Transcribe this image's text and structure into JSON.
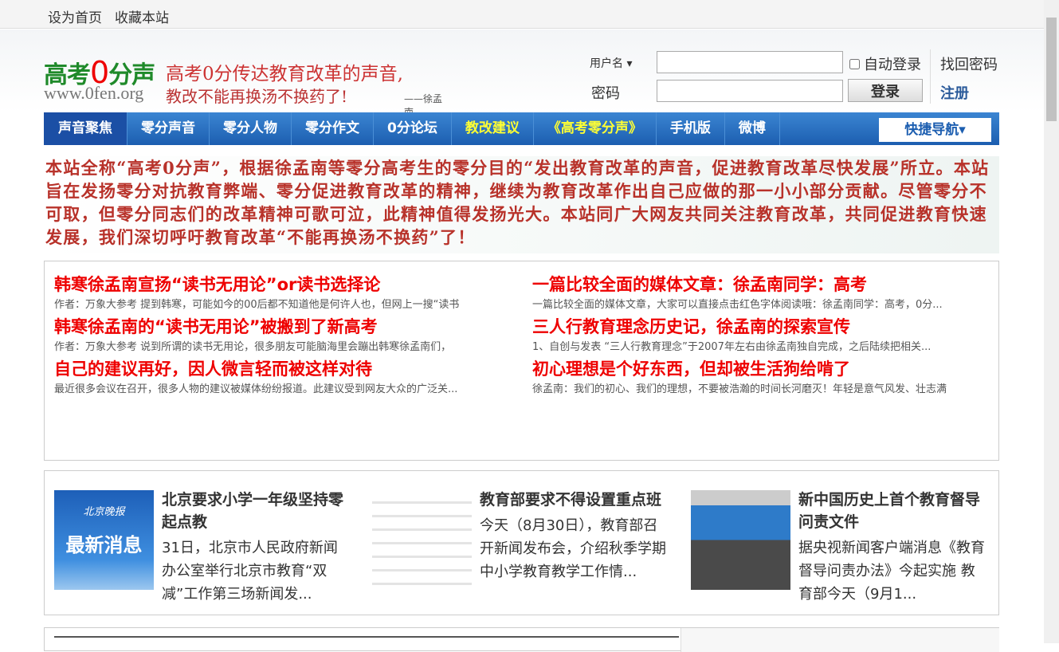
{
  "topbar": {
    "set_home": "设为首页",
    "bookmark": "收藏本站"
  },
  "logo": {
    "name_a": "高考",
    "name_zero": "0",
    "name_b": "分声",
    "slogan1": "高考0分传达教育改革的声音,",
    "url": "www.0fen.org",
    "slogan2": "教改不能再换汤不换药了!",
    "signature": "——徐孟南"
  },
  "login": {
    "username_label": "用户名 ▾",
    "password_label": "密码",
    "username_value": "",
    "password_value": "",
    "auto_login": "自动登录",
    "forgot": "找回密码",
    "login_button": "登录",
    "register": "注册"
  },
  "nav": {
    "items": [
      "声音聚焦",
      "零分声音",
      "零分人物",
      "零分作文",
      "0分论坛",
      "教改建议",
      "《高考零分声》",
      "手机版",
      "微博"
    ],
    "quick": "快捷导航▾"
  },
  "intro": "本站全称“高考0分声”，根据徐孟南等零分高考生的零分目的“发出教育改革的声音，促进教育改革尽快发展”所立。本站旨在发扬零分对抗教育弊端、零分促进教育改革的精神，继续为教育改革作出自己应做的那一小小部分贡献。尽管零分不可取，但零分同志们的改革精神可歌可泣，此精神值得发扬光大。本站同广大网友共同关注教育改革，共同促进教育快速发展，我们深切呼吁教育改革“不能再换汤不换药”了！",
  "featured": [
    [
      {
        "title": "韩寒徐孟南宣扬“读书无用论”or读书选择论",
        "summary": "作者：万象大参考 提到韩寒，可能如今的00后都不知道他是何许人也，但网上一搜“读书"
      },
      {
        "title": "韩寒徐孟南的“读书无用论”被搬到了新高考",
        "summary": "作者：万象大参考 说到所谓的读书无用论，很多朋友可能脑海里会蹦出韩寒徐孟南们，"
      },
      {
        "title": "自己的建议再好，因人微言轻而被这样对待",
        "summary": "最近很多会议在召开，很多人物的建议被媒体纷纷报道。此建议受到网友大众的广泛关..."
      }
    ],
    [
      {
        "title": "一篇比较全面的媒体文章：徐孟南同学：高考",
        "summary": "一篇比较全面的媒体文章，大家可以直接点击红色字体阅读哦：徐孟南同学：高考，0分..."
      },
      {
        "title": "三人行教育理念历史记，徐孟南的探索宣传",
        "summary": "1、自创与发表 “三人行教育理念”于2007年左右由徐孟南独自完成，之后陆续把相关..."
      },
      {
        "title": "初心理想是个好东西，但却被生活狗给啃了",
        "summary": "徐孟南：我们的初心、我们的理想，不要被浩瀚的时间长河磨灭！年轻是意气风发、壮志满"
      }
    ]
  ],
  "news": [
    {
      "title": "北京要求小学一年级坚持零起点教",
      "summary": "31日，北京市人民政府新闻办公室举行北京市教育“双减”工作第三场新闻发...",
      "thumb_text1": "北京晚报",
      "thumb_text2": "最新消息"
    },
    {
      "title": "教育部要求不得设置重点班",
      "summary": "今天（8月30日），教育部召开新闻发布会，介绍秋季学期中小学教育教学工作情..."
    },
    {
      "title": "新中国历史上首个教育督导问责文件",
      "summary": "据央视新闻客户端消息《教育督导问责办法》今起实施 教育部今天（9月1..."
    }
  ],
  "colors": {
    "nav": "#1c5eb0",
    "headline": "#ee0000",
    "intro": "#b8322a"
  }
}
